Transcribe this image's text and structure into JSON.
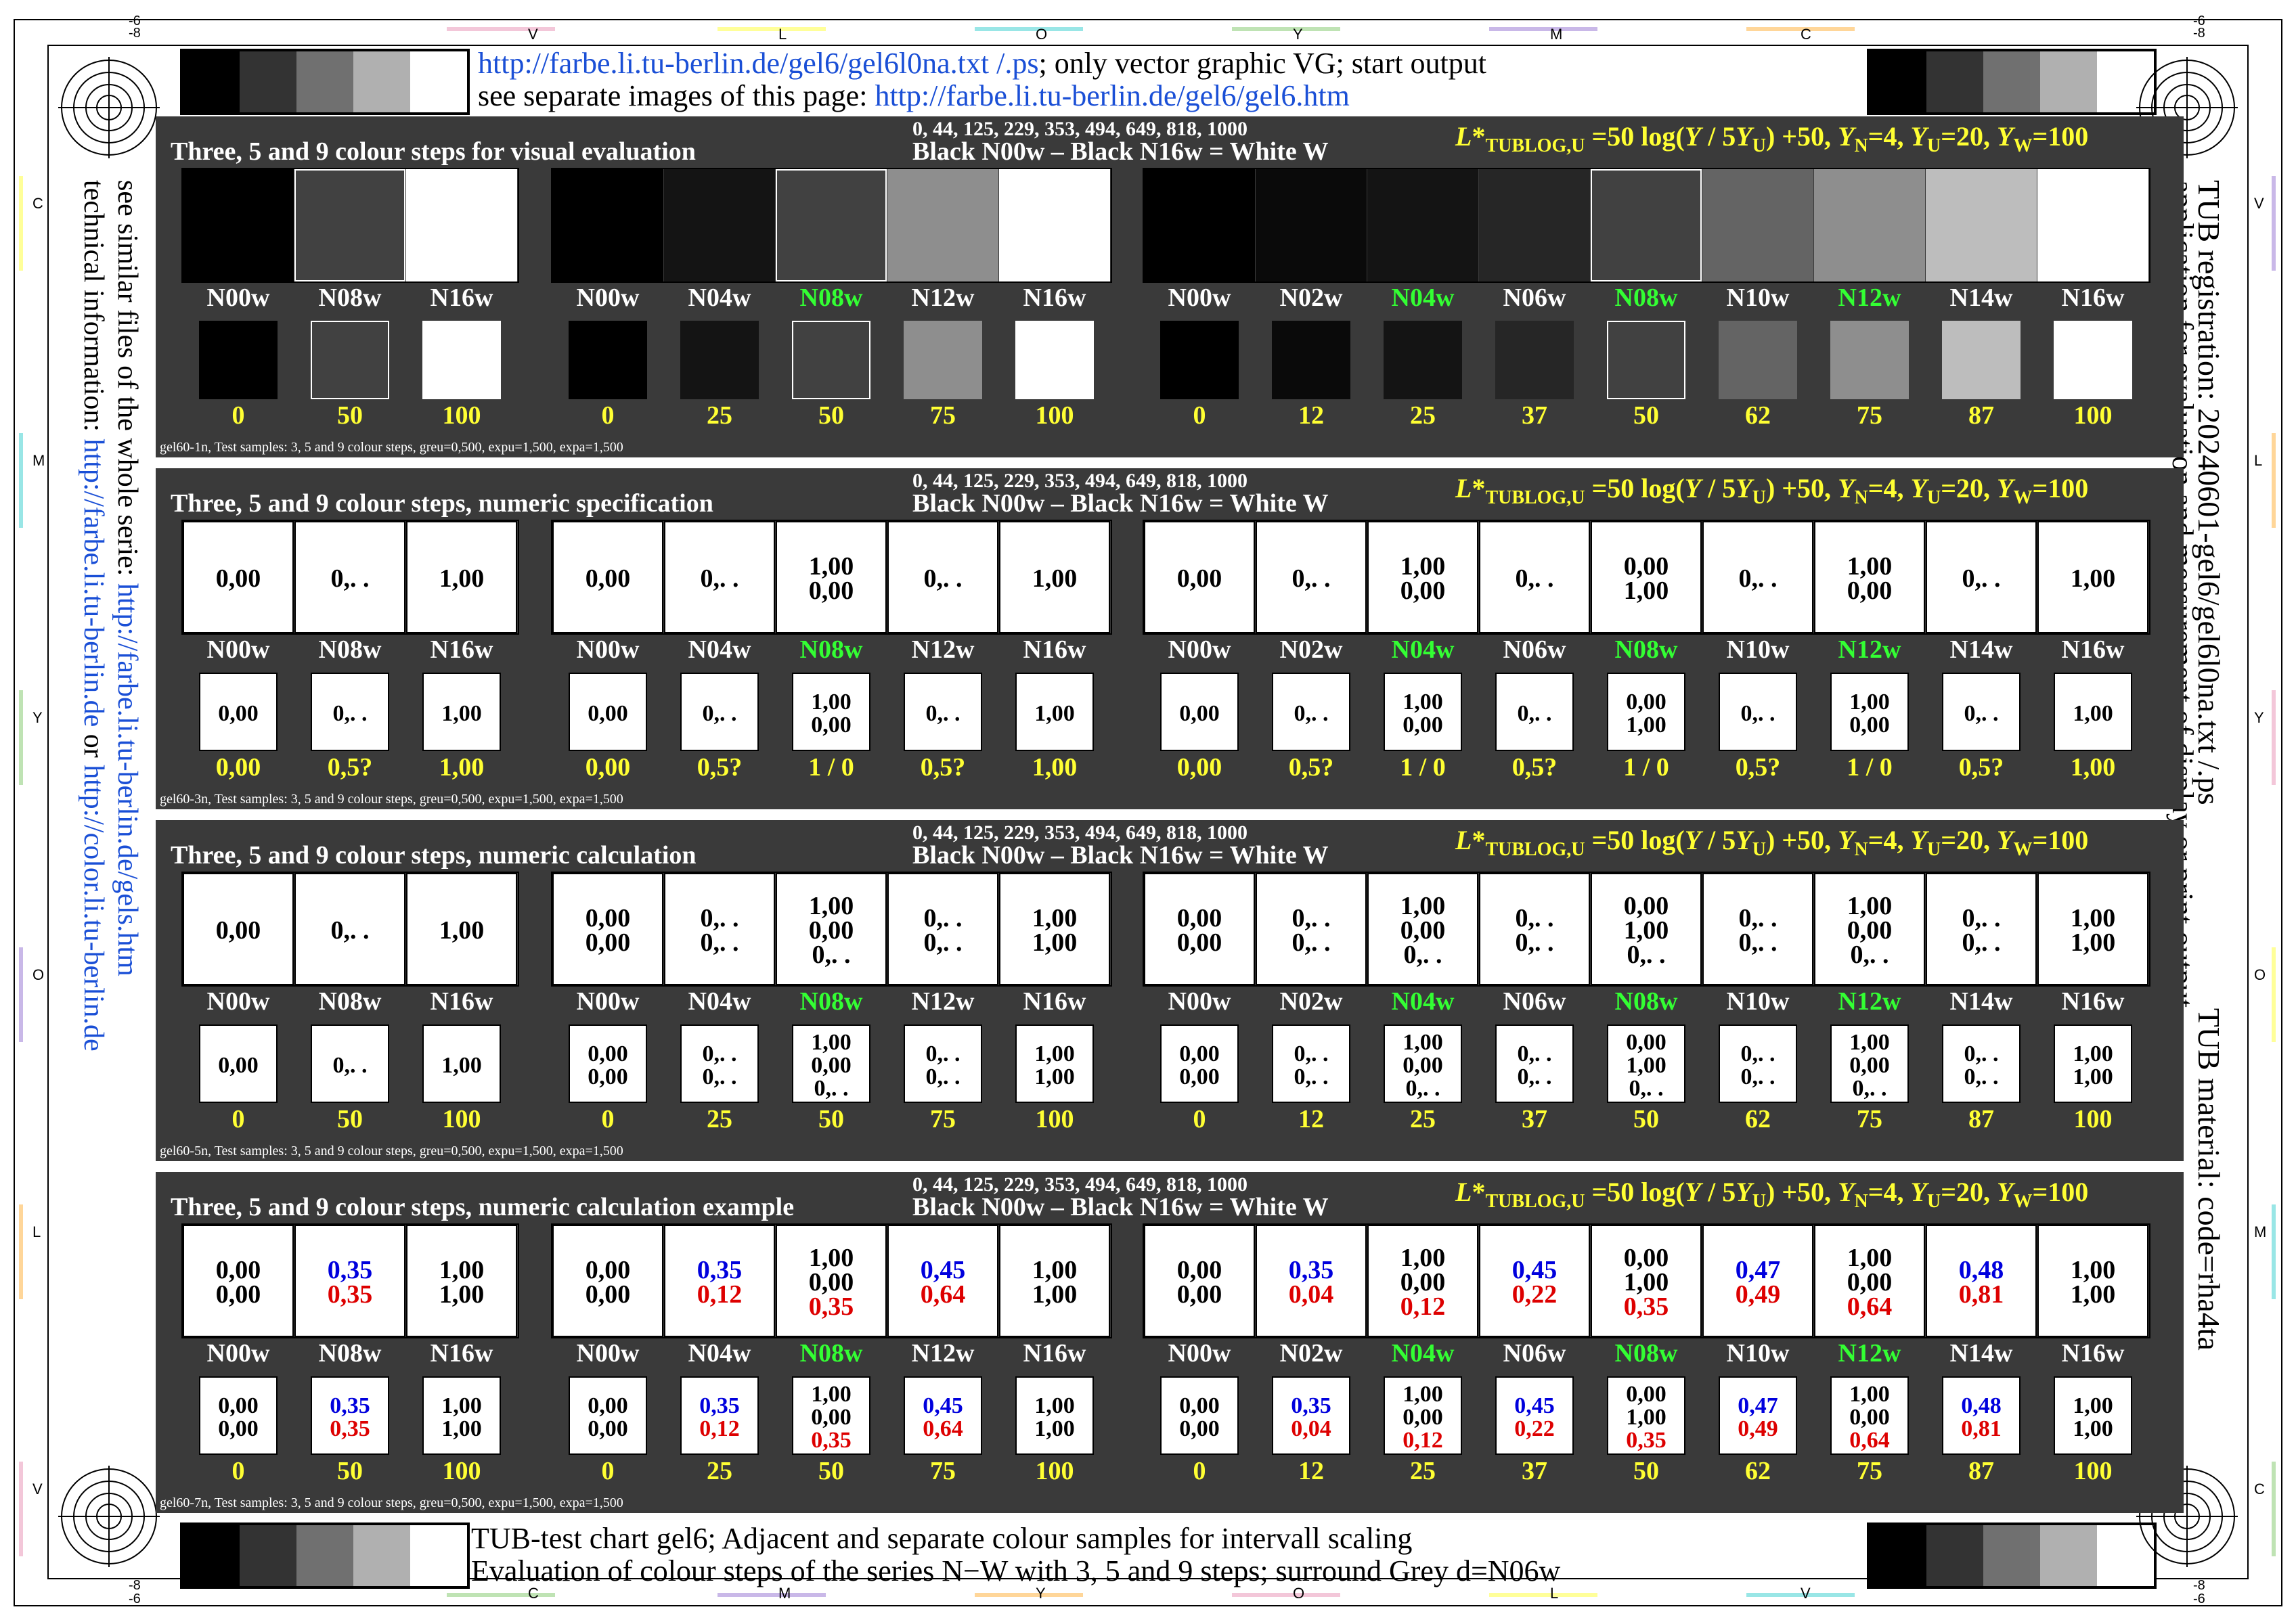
{
  "header": {
    "line1_link": "http://farbe.li.tu-berlin.de/gel6/gel6l0na.txt /.ps",
    "line1_text": "; only vector graphic VG; start output",
    "line2_text": "see separate images of this page: ",
    "line2_link": "http://farbe.li.tu-berlin.de/gel6/gel6.htm"
  },
  "footer": {
    "line1": "TUB-test chart gel6; Adjacent and separate colour samples for intervall scaling",
    "line2": "Evaluation of colour steps of the series N−W with 3, 5 and 9 steps; surround Grey d=N06w"
  },
  "left_side": {
    "line1_text": "see similar files of the whole serie: ",
    "line1_link": "http://farbe.li.tu-berlin.de/gels.htm",
    "line2_text": "technical information: ",
    "line2_link": "http://farbe.li.tu-berlin.de",
    "line2_or": " or ",
    "line2_link2": "http://color.li.tu-berlin.de"
  },
  "right_side": {
    "line1": "TUB registration: 20240601-gel6/gel6l0na.txt /.ps",
    "line1b": "TUB material: code=rha4ta",
    "line2": "application for evaluation and measurement of display or print output"
  },
  "edge_labels": {
    "top": [
      "V",
      "L",
      "O",
      "Y",
      "M",
      "C"
    ],
    "bottom": [
      "C",
      "M",
      "Y",
      "O",
      "L",
      "V"
    ],
    "left": [
      "C",
      "M",
      "Y",
      "O",
      "L",
      "V"
    ],
    "right": [
      "V",
      "L",
      "Y",
      "O",
      "M",
      "C"
    ],
    "corner_top": "-6",
    "corner_top2": "-8",
    "corner_bottom": "-8",
    "corner_bottom2": "-6"
  },
  "common": {
    "mid_line1": "0, 44, 125, 229, 353, 494, 649, 818, 1000",
    "mid_line2": "Black N00w – Black N16w = White W",
    "formula": "L*TUBLOG,U =50 log(Y / 5YU) +50, YN=4, YU=20, YW=100"
  },
  "groups": {
    "g3": {
      "labels": [
        "N00w",
        "N08w",
        "N16w"
      ],
      "greys": [
        "#000000",
        "#414141",
        "#ffffff"
      ],
      "green": [
        false,
        false,
        false
      ],
      "values": [
        "0",
        "50",
        "100"
      ]
    },
    "g5": {
      "labels": [
        "N00w",
        "N04w",
        "N08w",
        "N12w",
        "N16w"
      ],
      "greys": [
        "#000000",
        "#141414",
        "#414141",
        "#8e8e8e",
        "#ffffff"
      ],
      "green": [
        false,
        false,
        true,
        false,
        false
      ],
      "values": [
        "0",
        "25",
        "50",
        "75",
        "100"
      ]
    },
    "g9": {
      "labels": [
        "N00w",
        "N02w",
        "N04w",
        "N06w",
        "N08w",
        "N10w",
        "N12w",
        "N14w",
        "N16w"
      ],
      "greys": [
        "#000000",
        "#0a0a0a",
        "#141414",
        "#262626",
        "#414141",
        "#646464",
        "#8e8e8e",
        "#bdbdbd",
        "#ffffff"
      ],
      "green": [
        false,
        false,
        true,
        false,
        true,
        false,
        true,
        false,
        false
      ],
      "values": [
        "0",
        "12",
        "25",
        "37",
        "50",
        "62",
        "75",
        "87",
        "100"
      ]
    }
  },
  "panels": [
    {
      "title": "Three, 5 and 9 colour steps for visual evaluation",
      "footnote": "gel60-1n, Test samples: 3, 5 and 9 colour steps, greu=0,500, expu=1,500, expa=1,500",
      "kind": "visual"
    },
    {
      "title": "Three, 5 and 9 colour steps, numeric specification",
      "footnote": "gel60-3n, Test samples: 3, 5 and 9 colour steps, greu=0,500, expu=1,500, expa=1,500",
      "kind": "numeric",
      "value_rows": {
        "g3": [
          "0,00",
          "0,5?",
          "1,00"
        ],
        "g5": [
          "0,00",
          "0,5?",
          "1 / 0",
          "0,5?",
          "1,00"
        ],
        "g9": [
          "0,00",
          "0,5?",
          "1 / 0",
          "0,5?",
          "1 / 0",
          "0,5?",
          "1 / 0",
          "0,5?",
          "1,00"
        ]
      },
      "cells": {
        "g3": [
          [
            [
              "0,00",
              "k"
            ]
          ],
          [
            [
              "0,. .",
              "k"
            ]
          ],
          [
            [
              "1,00",
              "k"
            ]
          ]
        ],
        "g5": [
          [
            [
              "0,00",
              "k"
            ]
          ],
          [
            [
              "0,. .",
              "k"
            ]
          ],
          [
            [
              "1,00",
              "k"
            ],
            [
              "0,00",
              "k"
            ]
          ],
          [
            [
              "0,. .",
              "k"
            ]
          ],
          [
            [
              "1,00",
              "k"
            ]
          ]
        ],
        "g9": [
          [
            [
              "0,00",
              "k"
            ]
          ],
          [
            [
              "0,. .",
              "k"
            ]
          ],
          [
            [
              "1,00",
              "k"
            ],
            [
              "0,00",
              "k"
            ]
          ],
          [
            [
              "0,. .",
              "k"
            ]
          ],
          [
            [
              "0,00",
              "k"
            ],
            [
              "1,00",
              "k"
            ]
          ],
          [
            [
              "0,. .",
              "k"
            ]
          ],
          [
            [
              "1,00",
              "k"
            ],
            [
              "0,00",
              "k"
            ]
          ],
          [
            [
              "0,. .",
              "k"
            ]
          ],
          [
            [
              "1,00",
              "k"
            ]
          ]
        ]
      }
    },
    {
      "title": "Three, 5 and 9 colour steps, numeric calculation",
      "footnote": "gel60-5n, Test samples: 3, 5 and 9 colour steps, greu=0,500, expu=1,500, expa=1,500",
      "kind": "numeric",
      "cells": {
        "g3": [
          [
            [
              "0,00",
              "k"
            ]
          ],
          [
            [
              "0,. .",
              "k"
            ]
          ],
          [
            [
              "1,00",
              "k"
            ]
          ]
        ],
        "g5": [
          [
            [
              "0,00",
              "k"
            ],
            [
              "0,00",
              "k"
            ]
          ],
          [
            [
              "0,. .",
              "k"
            ],
            [
              "0,. .",
              "k"
            ]
          ],
          [
            [
              "1,00",
              "k"
            ],
            [
              "0,00",
              "k"
            ],
            [
              "0,. .",
              "k"
            ]
          ],
          [
            [
              "0,. .",
              "k"
            ],
            [
              "0,. .",
              "k"
            ]
          ],
          [
            [
              "1,00",
              "k"
            ],
            [
              "1,00",
              "k"
            ]
          ]
        ],
        "g9": [
          [
            [
              "0,00",
              "k"
            ],
            [
              "0,00",
              "k"
            ]
          ],
          [
            [
              "0,. .",
              "k"
            ],
            [
              "0,. .",
              "k"
            ]
          ],
          [
            [
              "1,00",
              "k"
            ],
            [
              "0,00",
              "k"
            ],
            [
              "0,. .",
              "k"
            ]
          ],
          [
            [
              "0,. .",
              "k"
            ],
            [
              "0,. .",
              "k"
            ]
          ],
          [
            [
              "0,00",
              "k"
            ],
            [
              "1,00",
              "k"
            ],
            [
              "0,. .",
              "k"
            ]
          ],
          [
            [
              "0,. .",
              "k"
            ],
            [
              "0,. .",
              "k"
            ]
          ],
          [
            [
              "1,00",
              "k"
            ],
            [
              "0,00",
              "k"
            ],
            [
              "0,. .",
              "k"
            ]
          ],
          [
            [
              "0,. .",
              "k"
            ],
            [
              "0,. .",
              "k"
            ]
          ],
          [
            [
              "1,00",
              "k"
            ],
            [
              "1,00",
              "k"
            ]
          ]
        ]
      }
    },
    {
      "title": "Three, 5 and 9 colour steps, numeric calculation example",
      "footnote": "gel60-7n, Test samples: 3, 5 and 9 colour steps, greu=0,500, expu=1,500, expa=1,500",
      "kind": "numeric",
      "cells": {
        "g3": [
          [
            [
              "0,00",
              "k"
            ],
            [
              "0,00",
              "k"
            ]
          ],
          [
            [
              "0,35",
              "b"
            ],
            [
              "0,35",
              "r"
            ]
          ],
          [
            [
              "1,00",
              "k"
            ],
            [
              "1,00",
              "k"
            ]
          ]
        ],
        "g5": [
          [
            [
              "0,00",
              "k"
            ],
            [
              "0,00",
              "k"
            ]
          ],
          [
            [
              "0,35",
              "b"
            ],
            [
              "0,12",
              "r"
            ]
          ],
          [
            [
              "1,00",
              "k"
            ],
            [
              "0,00",
              "k"
            ],
            [
              "0,35",
              "r"
            ]
          ],
          [
            [
              "0,45",
              "b"
            ],
            [
              "0,64",
              "r"
            ]
          ],
          [
            [
              "1,00",
              "k"
            ],
            [
              "1,00",
              "k"
            ]
          ]
        ],
        "g9": [
          [
            [
              "0,00",
              "k"
            ],
            [
              "0,00",
              "k"
            ]
          ],
          [
            [
              "0,35",
              "b"
            ],
            [
              "0,04",
              "r"
            ]
          ],
          [
            [
              "1,00",
              "k"
            ],
            [
              "0,00",
              "k"
            ],
            [
              "0,12",
              "r"
            ]
          ],
          [
            [
              "0,45",
              "b"
            ],
            [
              "0,22",
              "r"
            ]
          ],
          [
            [
              "0,00",
              "k"
            ],
            [
              "1,00",
              "k"
            ],
            [
              "0,35",
              "r"
            ]
          ],
          [
            [
              "0,47",
              "b"
            ],
            [
              "0,49",
              "r"
            ]
          ],
          [
            [
              "1,00",
              "k"
            ],
            [
              "0,00",
              "k"
            ],
            [
              "0,64",
              "r"
            ]
          ],
          [
            [
              "0,48",
              "b"
            ],
            [
              "0,81",
              "r"
            ]
          ],
          [
            [
              "1,00",
              "k"
            ],
            [
              "1,00",
              "k"
            ]
          ]
        ]
      }
    }
  ],
  "grey_strip": [
    "#000000",
    "#333333",
    "#707070",
    "#b0b0b0",
    "#ffffff"
  ]
}
